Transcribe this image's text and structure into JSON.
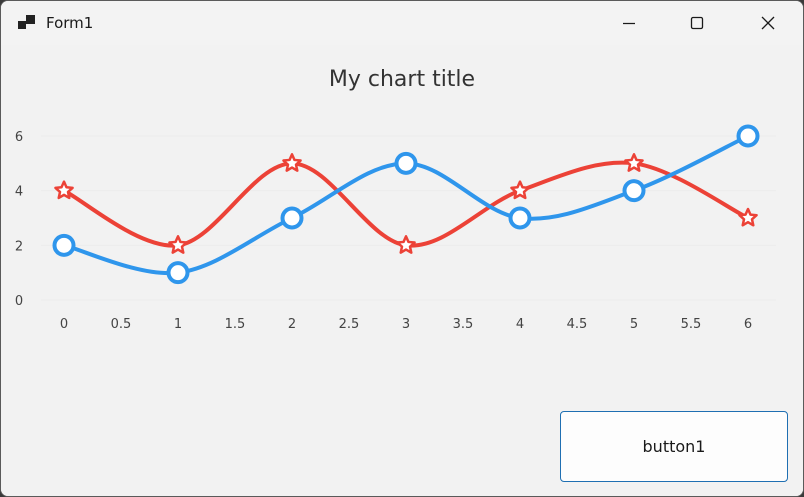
{
  "window": {
    "title": "Form1",
    "controls": {
      "minimize": "minimize-icon",
      "maximize": "maximize-icon",
      "close": "close-icon"
    }
  },
  "button1": {
    "label": "button1"
  },
  "colors": {
    "series_blue": "#2f96ec",
    "series_red": "#ec4237",
    "window_bg": "#f2f2f2",
    "button_border": "#1f6fb2"
  },
  "chart_data": {
    "type": "line",
    "title": "My chart title",
    "xlabel": "",
    "ylabel": "",
    "xlim": [
      0,
      6
    ],
    "ylim": [
      0,
      6
    ],
    "xticks": [
      "0",
      "0.5",
      "1",
      "1.5",
      "2",
      "2.5",
      "3",
      "3.5",
      "4",
      "4.5",
      "5",
      "5.5",
      "6"
    ],
    "yticks": [
      "0",
      "2",
      "4",
      "6"
    ],
    "smooth": true,
    "grid": true,
    "legend": "none",
    "series": [
      {
        "x": [
          0,
          1,
          2,
          3,
          4,
          5,
          6
        ],
        "values": [
          2,
          1,
          3,
          5,
          3,
          4,
          6
        ],
        "color": "#2f96ec",
        "marker": "circle"
      },
      {
        "x": [
          0,
          1,
          2,
          3,
          4,
          5,
          6
        ],
        "values": [
          4,
          2,
          5,
          2,
          4,
          5,
          3
        ],
        "color": "#ec4237",
        "marker": "star"
      }
    ]
  }
}
